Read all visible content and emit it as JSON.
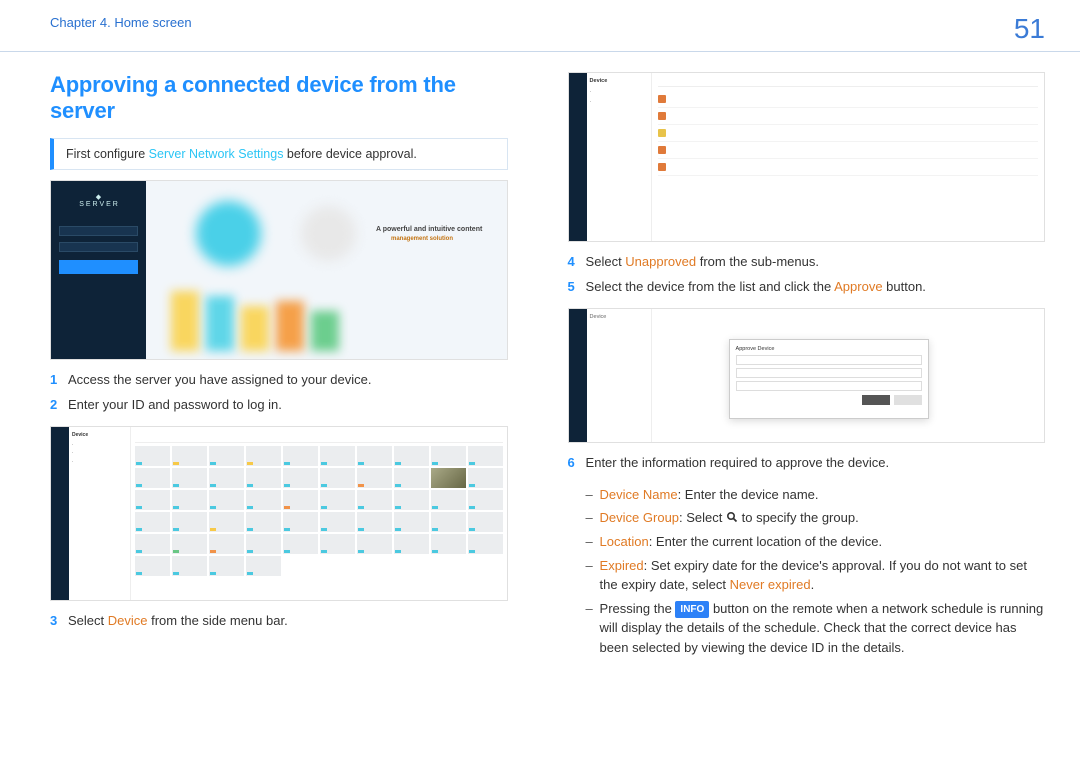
{
  "header": {
    "chapter": "Chapter 4. Home screen",
    "page_number": "51"
  },
  "left": {
    "title": "Approving a connected device from the server",
    "callout_pre": "First configure ",
    "callout_link": "Server Network Settings",
    "callout_post": " before device approval.",
    "login_caption1": "A powerful and intuitive content",
    "login_caption2": "management solution",
    "step1_num": "1",
    "step1_text": "Access the server you have assigned to your device.",
    "step2_num": "2",
    "step2_text": "Enter your ID and password to log in.",
    "grid_nav_hd": "Device",
    "step3_num": "3",
    "step3_pre": "Select ",
    "step3_em": "Device",
    "step3_post": " from the side menu bar."
  },
  "right": {
    "tbl_nav_hd": "Device",
    "step4_num": "4",
    "step4_pre": "Select ",
    "step4_em": "Unapproved",
    "step4_post": " from the sub-menus.",
    "step5_num": "5",
    "step5_pre": "Select the device from the list and click the ",
    "step5_em": "Approve",
    "step5_post": " button.",
    "mdl_nav_hd": "Device",
    "mdl_title": "Approve Device",
    "step6_num": "6",
    "step6_text": "Enter the information required to approve the device.",
    "b1_label": "Device Name",
    "b1_text": ": Enter the device name.",
    "b2_label": "Device Group",
    "b2_pre": ": Select ",
    "b2_post": " to specify the group.",
    "b3_label": "Location",
    "b3_text": ": Enter the current location of the device.",
    "b4_label": "Expired",
    "b4_pre": ": Set expiry date for the device's approval. If you do not want to set the expiry date, select ",
    "b4_em": "Never expired",
    "b4_post": ".",
    "b5_pre": "Pressing the ",
    "b5_chip": "INFO",
    "b5_post": " button on the remote when a network schedule is running will display the details of the schedule. Check that the correct device has been selected by viewing the device ID in the details."
  }
}
